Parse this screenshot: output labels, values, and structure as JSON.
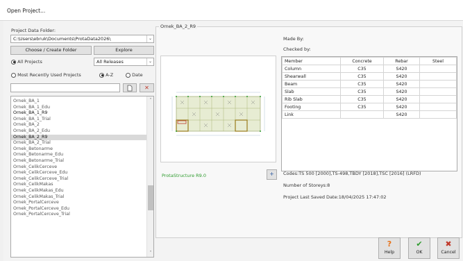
{
  "window": {
    "title": "Open Project..."
  },
  "left": {
    "folder_label": "Project Data Folder:",
    "folder_value": "C:\\Users\\ebruk\\Documents\\ProtaData2026\\",
    "choose_button": "Choose / Create Folder",
    "explore_button": "Explore",
    "all_projects_label": "All Projects",
    "release_filter": "All Releases",
    "recent_label": "Most Recently Used Projects",
    "az_label": "A-Z",
    "date_label": "Date",
    "filter_value": "",
    "projects": [
      "Ornek_BA_1",
      "Ornek_BA_1_Edu",
      "Ornek_BA_1_R9",
      "Ornek_BA_1_Trial",
      "Ornek_BA_2",
      "Ornek_BA_2_Edu",
      "Ornek_BA_2_R9",
      "Ornek_BA_2_Trial",
      "Ornek_Betonarme",
      "Ornek_Betonarme_Edu",
      "Ornek_Betonarme_Trial",
      "Ornek_CelikCerceve",
      "Ornek_CelikCerceve_Edu",
      "Ornek_CelikCerceve_Trial",
      "Ornek_CelikMakas",
      "Ornek_CelikMakas_Edu",
      "Ornek_CelikMakas_Trial",
      "Ornek_PortalCerceve",
      "Ornek_PortalCerceve_Edu",
      "Ornek_PortalCerceve_Trial"
    ],
    "selected_index": 6,
    "bold_index": 2
  },
  "right": {
    "group_title": "Ornek_BA_2_R9",
    "made_by_label": "Made By:",
    "checked_by_label": "Checked by:",
    "version": "ProtaStructure R9.0",
    "table": {
      "headers": [
        "Member",
        "Concrete",
        "Rebar",
        "Steel"
      ],
      "rows": [
        [
          "Column",
          "C35",
          "S420",
          ""
        ],
        [
          "Shearwall",
          "C35",
          "S420",
          ""
        ],
        [
          "Beam",
          "C35",
          "S420",
          ""
        ],
        [
          "Slab",
          "C35",
          "S420",
          ""
        ],
        [
          "Rib Slab",
          "C35",
          "S420",
          ""
        ],
        [
          "Footing",
          "C35",
          "S420",
          ""
        ],
        [
          "Link",
          "",
          "S420",
          ""
        ]
      ]
    },
    "codes": "Codes:TS 500 [2000],TS-498,TBDY [2018],TSC [2016] (LRFD)",
    "storeys": "Number of Storeys:8",
    "saved": "Project Last Saved Date:18/04/2025 17:47:02"
  },
  "buttons": {
    "help": "Help",
    "ok": "OK",
    "cancel": "Cancel"
  },
  "colors": {
    "accent_green": "#2e9b2e",
    "cancel_red": "#c0392b",
    "help_orange": "#e8731a"
  }
}
